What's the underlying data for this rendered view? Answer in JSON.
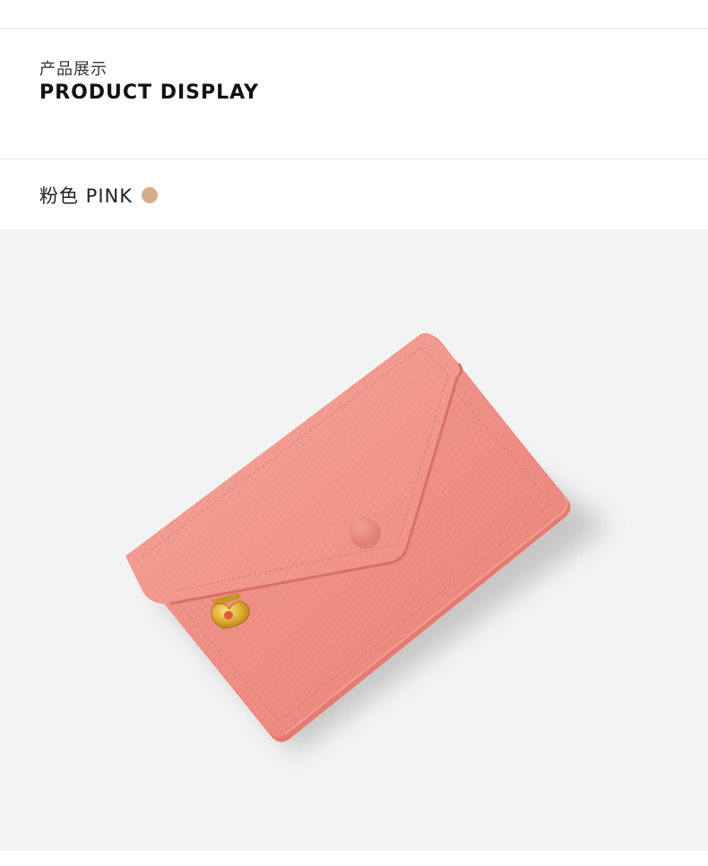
{
  "header": {
    "subtitle": "产品展示",
    "title": "PRODUCT DISPLAY"
  },
  "color_option": {
    "label": "粉色 PINK",
    "swatch_color": "#d9ab8e"
  },
  "product_photo": {
    "subject": "pink-envelope-card-wallet",
    "background_color": "#f3f3f3",
    "leather_color": "#ef8f86",
    "hardware_color": "#d4a22a"
  }
}
